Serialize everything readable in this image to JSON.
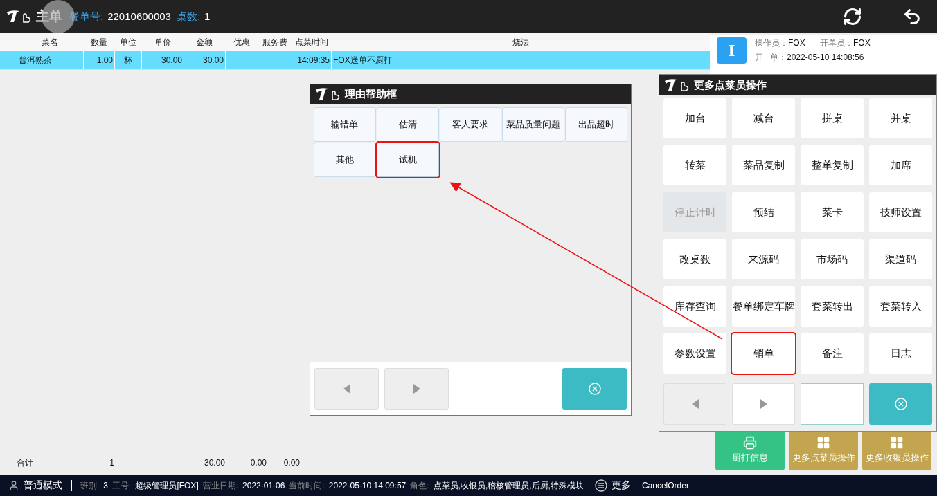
{
  "header": {
    "title": "主单",
    "order_label": "餐单号:",
    "order_no": "22010600003",
    "table_label": "桌数:",
    "table_count": "1"
  },
  "table": {
    "columns": [
      "菜名",
      "数量",
      "单位",
      "单价",
      "金额",
      "优惠",
      "服务费",
      "点菜时间",
      "烧法"
    ],
    "rows": [
      {
        "selected": true,
        "cells": [
          "普洱熟茶",
          "1.00",
          "杯",
          "30.00",
          "30.00",
          "",
          "",
          "14:09:35",
          "FOX送单不厨打"
        ]
      }
    ],
    "totals": {
      "label": "合计",
      "qty": "1",
      "amount": "30.00",
      "discount": "0.00",
      "service": "0.00"
    }
  },
  "info": {
    "badge": "I",
    "operator_label": "操作员：",
    "operator": "FOX",
    "opener_label": "开单员：",
    "opener": "FOX",
    "open_label": "开   单：",
    "open_time": "2022-05-10 14:08:56"
  },
  "reason_dialog": {
    "title": "理由帮助框",
    "reasons": [
      {
        "label": "输错单",
        "highlighted": false
      },
      {
        "label": "估清",
        "highlighted": false
      },
      {
        "label": "客人要求",
        "highlighted": false
      },
      {
        "label": "菜品质量问题",
        "highlighted": false
      },
      {
        "label": "出品超时",
        "highlighted": false
      },
      {
        "label": "其他",
        "highlighted": false
      },
      {
        "label": "试机",
        "highlighted": true
      }
    ]
  },
  "ops_dialog": {
    "title": "更多点菜员操作",
    "ops": [
      {
        "label": "加台",
        "disabled": false,
        "highlighted": false
      },
      {
        "label": "减台",
        "disabled": false,
        "highlighted": false
      },
      {
        "label": "拼桌",
        "disabled": false,
        "highlighted": false
      },
      {
        "label": "并桌",
        "disabled": false,
        "highlighted": false
      },
      {
        "label": "转菜",
        "disabled": false,
        "highlighted": false
      },
      {
        "label": "菜品复制",
        "disabled": false,
        "highlighted": false
      },
      {
        "label": "整单复制",
        "disabled": false,
        "highlighted": false
      },
      {
        "label": "加席",
        "disabled": false,
        "highlighted": false
      },
      {
        "label": "停止计时",
        "disabled": true,
        "highlighted": false
      },
      {
        "label": "预结",
        "disabled": false,
        "highlighted": false
      },
      {
        "label": "菜卡",
        "disabled": false,
        "highlighted": false
      },
      {
        "label": "技师设置",
        "disabled": false,
        "highlighted": false
      },
      {
        "label": "改桌数",
        "disabled": false,
        "highlighted": false
      },
      {
        "label": "来源码",
        "disabled": false,
        "highlighted": false
      },
      {
        "label": "市场码",
        "disabled": false,
        "highlighted": false
      },
      {
        "label": "渠道码",
        "disabled": false,
        "highlighted": false
      },
      {
        "label": "库存查询",
        "disabled": false,
        "highlighted": false
      },
      {
        "label": "餐单绑定车牌",
        "disabled": false,
        "highlighted": false
      },
      {
        "label": "套菜转出",
        "disabled": false,
        "highlighted": false
      },
      {
        "label": "套菜转入",
        "disabled": false,
        "highlighted": false
      },
      {
        "label": "参数设置",
        "disabled": false,
        "highlighted": false
      },
      {
        "label": "销单",
        "disabled": false,
        "highlighted": true
      },
      {
        "label": "备注",
        "disabled": false,
        "highlighted": false
      },
      {
        "label": "日志",
        "disabled": false,
        "highlighted": false
      }
    ]
  },
  "action_buttons": [
    {
      "label": "厨打信息",
      "kind": "print"
    },
    {
      "label": "更多点菜员操作",
      "kind": "grid"
    },
    {
      "label": "更多收银员操作",
      "kind": "grid"
    }
  ],
  "status_bar": {
    "mode": "普通模式",
    "fields": [
      {
        "label": "班别:",
        "value": "3"
      },
      {
        "label": "工号:",
        "value": "超级管理员[FOX]"
      },
      {
        "label": "营业日期:",
        "value": "2022-01-06"
      },
      {
        "label": "当前时间:",
        "value": "2022-05-10 14:09:57"
      },
      {
        "label": "角色:",
        "value": "点菜员,收银员,稽核管理员,后厨,特殊模块"
      }
    ],
    "more": "更多",
    "action": "CancelOrder"
  }
}
